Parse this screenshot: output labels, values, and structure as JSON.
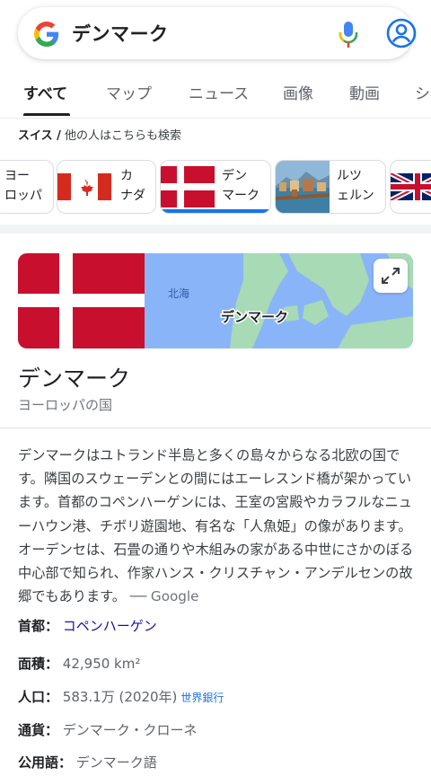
{
  "search": {
    "query": "デンマーク"
  },
  "tabs": [
    "すべて",
    "マップ",
    "ニュース",
    "画像",
    "動画",
    "シ"
  ],
  "related": {
    "prefix": "スイス /",
    "label": " 他の人はこちらも検索",
    "chips": [
      {
        "lines": [
          "ヨー",
          "ロッパ"
        ]
      },
      {
        "lines": [
          "カ",
          "ナダ"
        ]
      },
      {
        "lines": [
          "デン",
          "マーク"
        ]
      },
      {
        "lines": [
          "ルツ",
          "ェルン"
        ]
      }
    ]
  },
  "hero": {
    "map_sea_label": "北海",
    "map_country_label": "デンマーク"
  },
  "entity": {
    "title": "デンマーク",
    "subtitle": "ヨーロッパの国"
  },
  "description": {
    "text": "デンマークはユトランド半島と多くの島々からなる北欧の国です。隣国のスウェーデンとの間にはエーレスンド橋が架かっています。首都のコペンハーゲンには、王室の宮殿やカラフルなニューハウン港、チボリ遊園地、有名な「人魚姫」の像があります。オーデンセは、石畳の通りや木組みの家がある中世にさかのぼる中心部で知られ、作家ハンス・クリスチャン・アンデルセンの故郷でもあります。",
    "source": " ── Google"
  },
  "facts": [
    {
      "key": "首都：",
      "value": "コペンハーゲン",
      "note": ""
    },
    {
      "key": "面積：",
      "value": "42,950 km²",
      "note": ""
    },
    {
      "key": "人口：",
      "value": "583.1万 (2020年)",
      "note": "世界銀行"
    },
    {
      "key": "通貨：",
      "value": "デンマーク・クローネ",
      "note": ""
    },
    {
      "key": "公用語：",
      "value": "デンマーク語",
      "note": ""
    }
  ],
  "colors": {
    "accent": "#1a73e8",
    "link": "#1a0dab",
    "flag_red": "#c8102e"
  },
  "icons": [
    "google-g-icon",
    "mic-icon",
    "account-icon",
    "expand-icon"
  ]
}
